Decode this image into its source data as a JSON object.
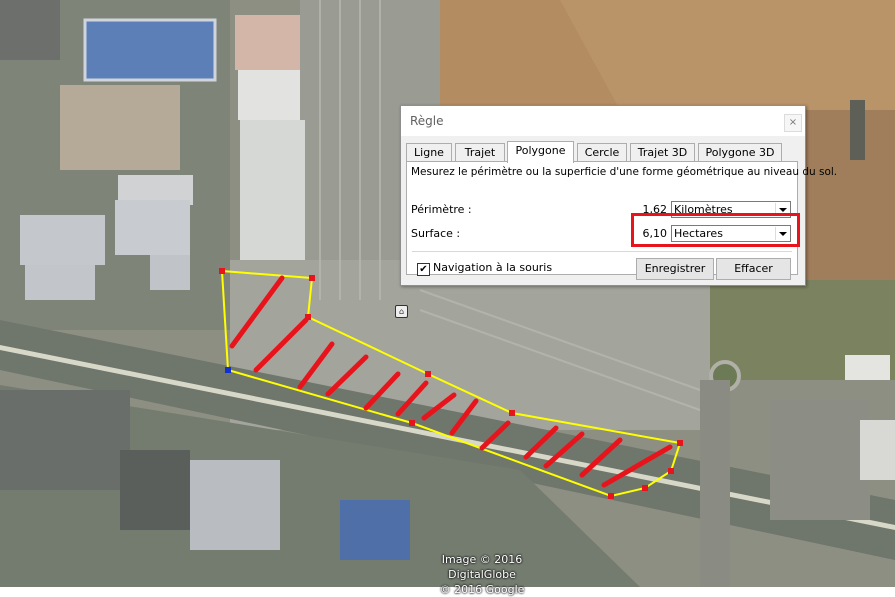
{
  "map": {
    "attribution_line1": "Image © 2016 DigitalGlobe",
    "attribution_line2": "© 2016 Google",
    "polygon_color": "#ffff00",
    "hatch_color": "#e8141c"
  },
  "dialog": {
    "title": "Règle",
    "close_glyph": "×",
    "tabs": [
      {
        "label": "Ligne"
      },
      {
        "label": "Trajet"
      },
      {
        "label": "Polygone"
      },
      {
        "label": "Cercle"
      },
      {
        "label": "Trajet 3D"
      },
      {
        "label": "Polygone 3D"
      }
    ],
    "active_tab": "Polygone",
    "description": "Mesurez le périmètre ou la superficie d'une forme géométrique au niveau du sol.",
    "perimeter": {
      "label": "Périmètre :",
      "value": "1,62",
      "unit": "Kilomètres"
    },
    "surface": {
      "label": "Surface :",
      "value": "6,10",
      "unit": "Hectares"
    },
    "highlight_color": "#e8141c",
    "mouse_nav": {
      "label": "Navigation à la souris",
      "checked": true,
      "check_glyph": "✔"
    },
    "buttons": {
      "save": "Enregistrer",
      "clear": "Effacer"
    }
  }
}
